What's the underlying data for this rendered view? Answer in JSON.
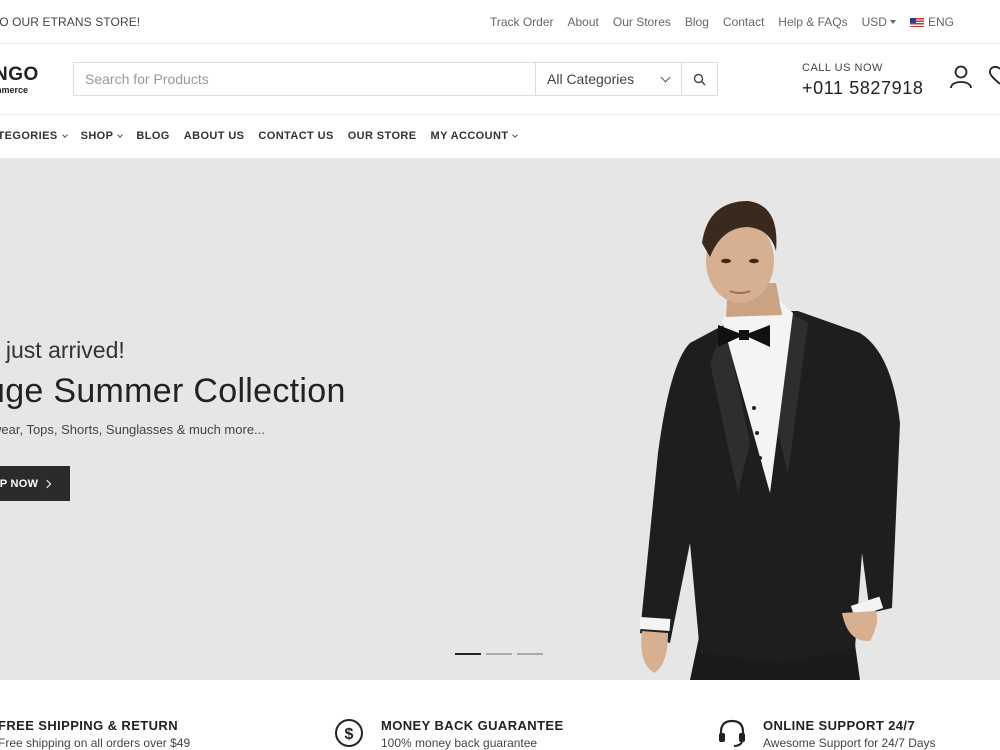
{
  "topbar": {
    "welcome": "TO OUR ETRANS STORE!",
    "links": [
      "Track Order",
      "About",
      "Our Stores",
      "Blog",
      "Contact",
      "Help & FAQs"
    ],
    "currency": "USD",
    "language": "ENG"
  },
  "header": {
    "logo_main": "NGO",
    "logo_sub": "nmerce",
    "search": {
      "placeholder": "Search for Products",
      "category": "All Categories"
    },
    "call_label": "CALL US NOW",
    "call_number": "+011 5827918"
  },
  "nav": {
    "items": [
      {
        "label": "ATEGORIES"
      },
      {
        "label": "SHOP"
      },
      {
        "label": "BLOG"
      },
      {
        "label": "ABOUT US"
      },
      {
        "label": "CONTACT US"
      },
      {
        "label": "OUR STORE"
      },
      {
        "label": "MY ACCOUNT"
      }
    ]
  },
  "hero": {
    "pretitle": "s just arrived!",
    "title": "uge Summer Collection",
    "description": "wear, Tops, Shorts, Sunglasses & much more...",
    "button": "P NOW",
    "slide_count": 3,
    "active_slide": 1
  },
  "features": [
    {
      "title": "FREE SHIPPING & RETURN",
      "subtitle": "Free shipping on all orders over $49"
    },
    {
      "title": "MONEY BACK GUARANTEE",
      "subtitle": "100% money back guarantee"
    },
    {
      "title": "ONLINE SUPPORT 24/7",
      "subtitle": "Awesome Support for 24/7 Days"
    }
  ],
  "colors": {
    "hero_bg": "#e6e6e6",
    "button_bg": "#2b2b2b",
    "text_dark": "#222222"
  }
}
